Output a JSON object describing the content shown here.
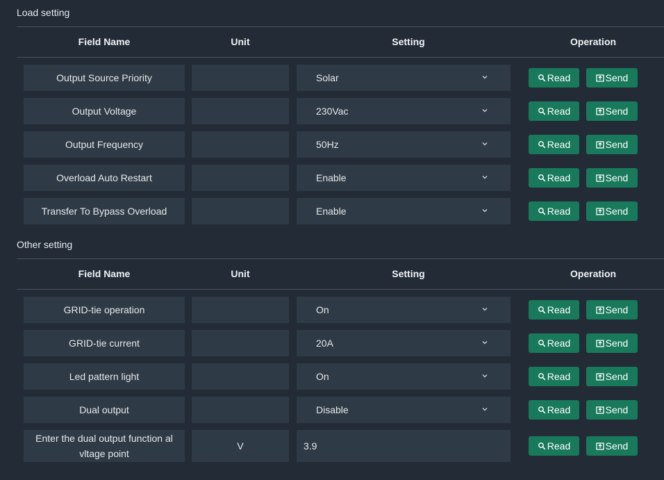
{
  "load_section": {
    "title": "Load setting",
    "headers": {
      "field": "Field Name",
      "unit": "Unit",
      "setting": "Setting",
      "operation": "Operation"
    },
    "rows": [
      {
        "field": "Output Source Priority",
        "unit": "",
        "setting": "Solar"
      },
      {
        "field": "Output Voltage",
        "unit": "",
        "setting": "230Vac"
      },
      {
        "field": "Output Frequency",
        "unit": "",
        "setting": "50Hz"
      },
      {
        "field": "Overload Auto Restart",
        "unit": "",
        "setting": "Enable"
      },
      {
        "field": "Transfer To Bypass Overload",
        "unit": "",
        "setting": "Enable"
      }
    ]
  },
  "other_section": {
    "title": "Other setting",
    "headers": {
      "field": "Field Name",
      "unit": "Unit",
      "setting": "Setting",
      "operation": "Operation"
    },
    "rows": [
      {
        "field": "GRID-tie operation",
        "unit": "",
        "setting": "On"
      },
      {
        "field": "GRID-tie current",
        "unit": "",
        "setting": "20A"
      },
      {
        "field": "Led pattern light",
        "unit": "",
        "setting": "On"
      },
      {
        "field": "Dual output",
        "unit": "",
        "setting": "Disable"
      },
      {
        "field": "Enter the dual output function al vltage point",
        "unit": "V",
        "setting": "3.9"
      }
    ]
  },
  "buttons": {
    "read_label": "Read",
    "send_label": "Send"
  },
  "icons": {
    "read": "search-refresh-icon",
    "send": "upload-icon",
    "dropdown": "chevron-down-icon"
  },
  "colors": {
    "button_bg": "#19795b",
    "cell_bg": "#2e3a45",
    "page_bg": "#222b36"
  }
}
